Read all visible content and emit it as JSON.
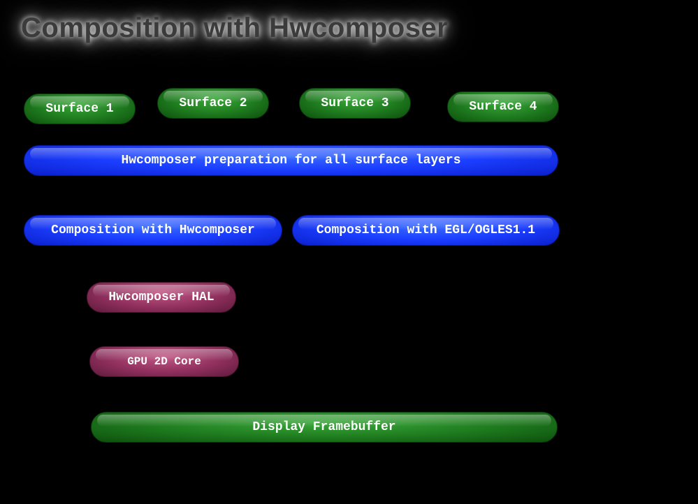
{
  "title": "Composition with Hwcomposer",
  "surfaces": {
    "s1": "Surface 1",
    "s2": "Surface 2",
    "s3": "Surface 3",
    "s4": "Surface 4"
  },
  "stages": {
    "prep": "Hwcomposer preparation for all surface layers",
    "comp_hwc": "Composition with Hwcomposer",
    "comp_egl": "Composition with EGL/OGLES1.1",
    "hal": "Hwcomposer HAL",
    "gpu2d": "GPU 2D Core",
    "framebuffer": "Display  Framebuffer"
  },
  "colors": {
    "green": "#1e7a1e",
    "blue": "#1b3eff",
    "maroon": "#8f2f5d",
    "background": "#000000"
  },
  "chart_data": {
    "type": "diagram",
    "title": "Composition with Hwcomposer",
    "nodes": [
      {
        "id": "s1",
        "label": "Surface 1",
        "group": "surface",
        "color": "green"
      },
      {
        "id": "s2",
        "label": "Surface 2",
        "group": "surface",
        "color": "green"
      },
      {
        "id": "s3",
        "label": "Surface 3",
        "group": "surface",
        "color": "green"
      },
      {
        "id": "s4",
        "label": "Surface 4",
        "group": "surface",
        "color": "green"
      },
      {
        "id": "prep",
        "label": "Hwcomposer preparation for all surface layers",
        "group": "prepare",
        "color": "blue"
      },
      {
        "id": "comp_hwc",
        "label": "Composition with Hwcomposer",
        "group": "composition",
        "color": "blue"
      },
      {
        "id": "comp_egl",
        "label": "Composition with EGL/OGLES1.1",
        "group": "composition",
        "color": "blue"
      },
      {
        "id": "hal",
        "label": "Hwcomposer HAL",
        "group": "hal",
        "color": "maroon"
      },
      {
        "id": "gpu2d",
        "label": "GPU 2D Core",
        "group": "gpu",
        "color": "maroon"
      },
      {
        "id": "fb",
        "label": "Display  Framebuffer",
        "group": "output",
        "color": "green"
      }
    ],
    "edges": [
      {
        "from": "s1",
        "to": "prep"
      },
      {
        "from": "s2",
        "to": "prep"
      },
      {
        "from": "s3",
        "to": "prep"
      },
      {
        "from": "s4",
        "to": "prep"
      },
      {
        "from": "prep",
        "to": "comp_hwc"
      },
      {
        "from": "prep",
        "to": "comp_egl"
      },
      {
        "from": "comp_hwc",
        "to": "hal"
      },
      {
        "from": "hal",
        "to": "gpu2d"
      },
      {
        "from": "gpu2d",
        "to": "fb"
      },
      {
        "from": "comp_egl",
        "to": "fb"
      }
    ]
  }
}
